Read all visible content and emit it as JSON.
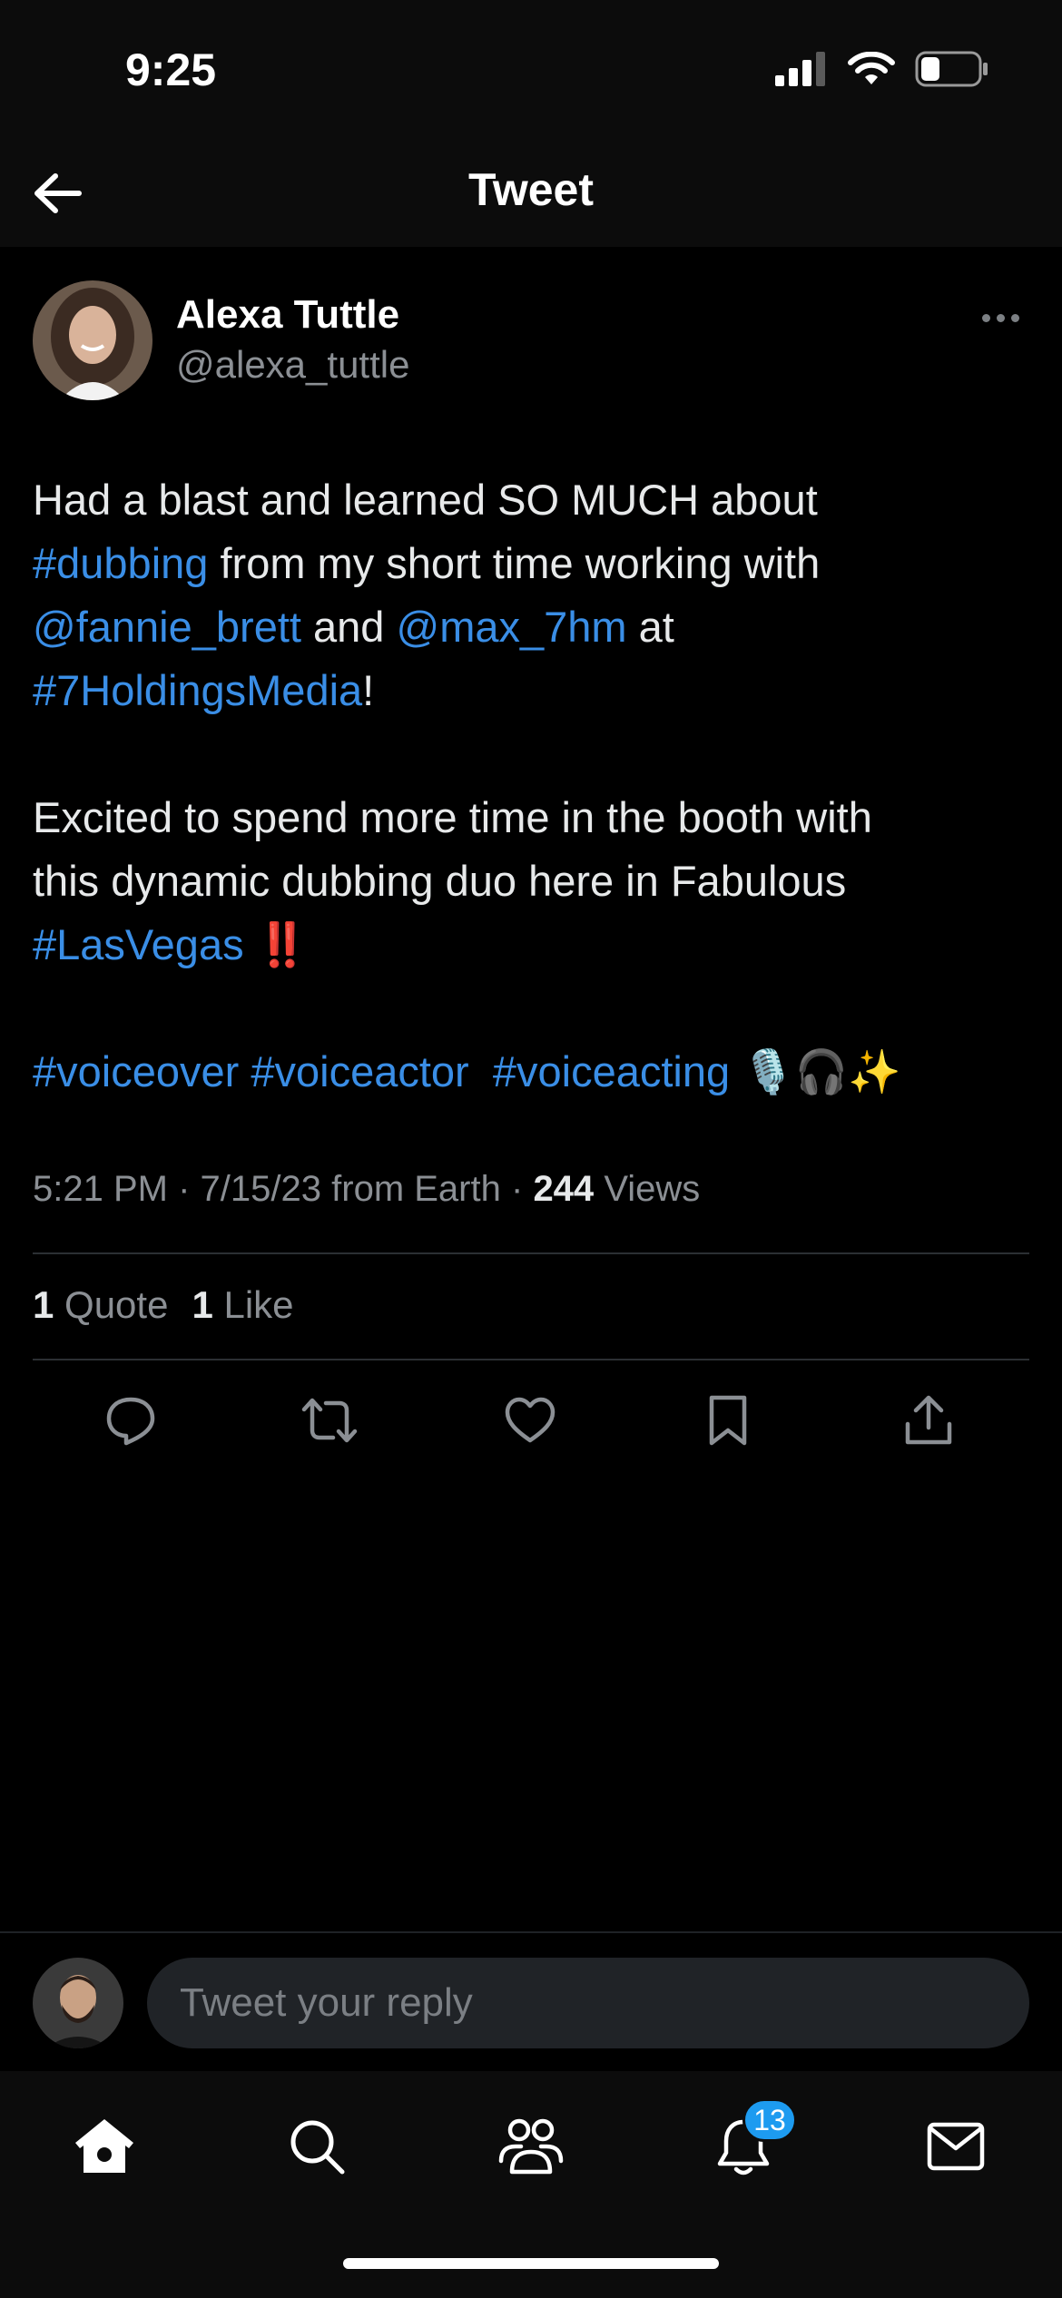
{
  "status_bar": {
    "time": "9:25"
  },
  "nav": {
    "title": "Tweet"
  },
  "tweet": {
    "author_name": "Alexa Tuttle",
    "author_handle": "@alexa_tuttle",
    "para1": {
      "t1": "Had a blast and learned SO MUCH about",
      "h_dubbing": "#dubbing",
      "t2": " from my short time working with",
      "m_fannie": "@fannie_brett",
      "t3": " and ",
      "m_max": "@max_7hm",
      "t4": " at",
      "h_7holdings": "#7HoldingsMedia",
      "t5": "!"
    },
    "para2": {
      "t1": "Excited to spend more time in the booth with",
      "t2": "this dynamic dubbing duo here in Fabulous",
      "h_lasvegas": "#LasVegas",
      "t3": " ‼️"
    },
    "para3": {
      "h_voiceover": "#voiceover",
      "h_voiceactor": "#voiceactor",
      "h_voiceacting": "#voiceacting",
      "emoji": "🎙️🎧✨"
    },
    "meta": {
      "time": "5:21 PM",
      "date": "7/15/23",
      "source": "from Earth",
      "views_count": "244",
      "views_label": "Views"
    },
    "stats": {
      "quote_count": "1",
      "quote_label": "Quote",
      "like_count": "1",
      "like_label": "Like"
    }
  },
  "reply": {
    "placeholder": "Tweet your reply"
  },
  "tabbar": {
    "notifications_badge": "13"
  },
  "icons": {
    "back": "arrow-left-icon",
    "more": "more-horizontal-icon",
    "reply": "reply-icon",
    "retweet": "retweet-icon",
    "like": "heart-icon",
    "bookmark": "bookmark-icon",
    "share": "share-icon",
    "home": "home-icon",
    "search": "search-icon",
    "communities": "communities-icon",
    "notifications": "bell-icon",
    "messages": "mail-icon"
  },
  "colors": {
    "background": "#000000",
    "link": "#3a8ee6",
    "badge": "#1d9bf0",
    "secondary_text": "#8b8f94"
  }
}
